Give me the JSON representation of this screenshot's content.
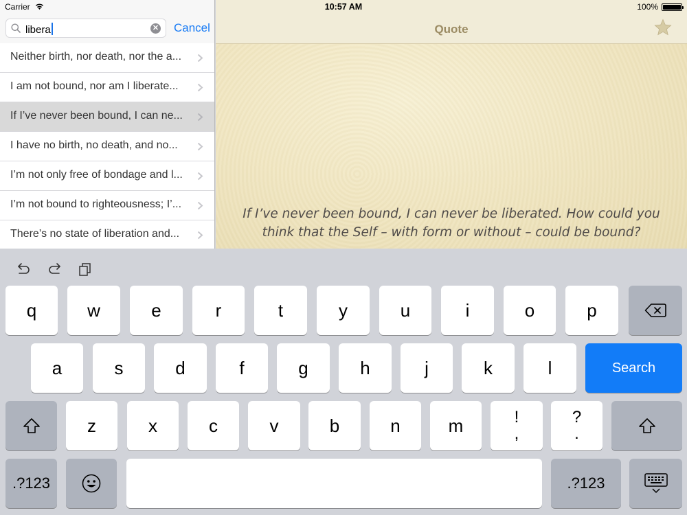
{
  "status_bar": {
    "carrier": "Carrier",
    "time": "10:57 AM",
    "battery": "100%"
  },
  "search": {
    "query": "libera",
    "cancel_label": "Cancel"
  },
  "results": [
    {
      "text": "Neither birth, nor death, nor the a...",
      "selected": false
    },
    {
      "text": "I am not bound, nor am I liberate...",
      "selected": false
    },
    {
      "text": "If I’ve never been bound, I can ne...",
      "selected": true
    },
    {
      "text": "I have no birth, no death, and no...",
      "selected": false
    },
    {
      "text": "I’m not only free of bondage and l...",
      "selected": false
    },
    {
      "text": "I’m not bound to righteousness; I’...",
      "selected": false
    },
    {
      "text": "There’s no state of liberation and...",
      "selected": false
    }
  ],
  "detail": {
    "title": "Quote",
    "quote": "If I’ve never been bound, I can never be liberated. How could you think that the Self –  with form or without – could be bound?"
  },
  "keyboard": {
    "row1": [
      "q",
      "w",
      "e",
      "r",
      "t",
      "y",
      "u",
      "i",
      "o",
      "p"
    ],
    "row2": [
      "a",
      "s",
      "d",
      "f",
      "g",
      "h",
      "j",
      "k",
      "l"
    ],
    "row3": [
      "z",
      "x",
      "c",
      "v",
      "b",
      "n",
      "m"
    ],
    "punct1": [
      "!",
      ","
    ],
    "punct2": [
      "?",
      "."
    ],
    "search_label": "Search",
    "numbers_label": ".?123"
  },
  "colors": {
    "accent": "#1a7cf5",
    "search_key": "#127cf8",
    "title": "#9b8b63"
  }
}
